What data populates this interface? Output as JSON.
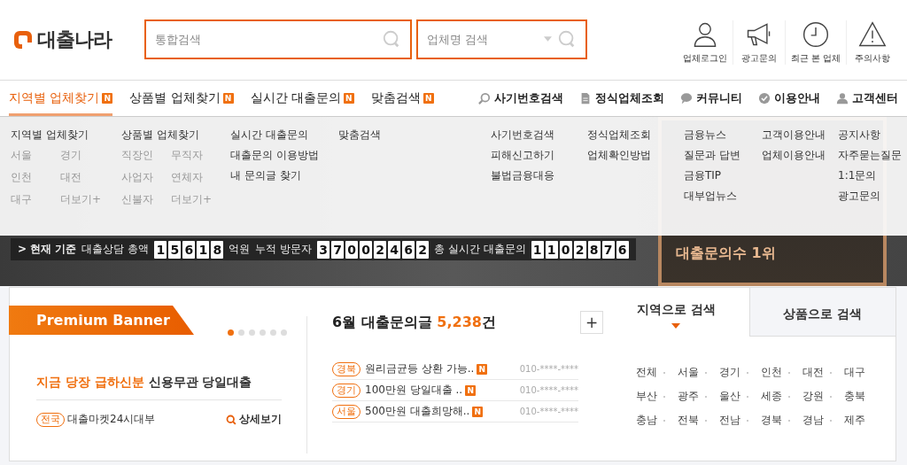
{
  "header": {
    "logo": "대출나라",
    "search": {
      "placeholder": "통합검색"
    },
    "company_search": {
      "placeholder": "업체명 검색"
    },
    "shortcuts": [
      {
        "kind": "person",
        "label": "업체로그인"
      },
      {
        "kind": "megaphone",
        "label": "광고문의"
      },
      {
        "kind": "clock",
        "label": "최근 본 업체"
      },
      {
        "kind": "warning",
        "label": "주의사항"
      }
    ]
  },
  "nav": {
    "main": [
      {
        "label": "지역별 업체찾기",
        "badge": "N",
        "selected": true
      },
      {
        "label": "상품별 업체찾기",
        "badge": "N",
        "selected": false
      },
      {
        "label": "실시간 대출문의",
        "badge": "N",
        "selected": false
      },
      {
        "label": "맞춤검색",
        "badge": "N",
        "selected": false
      }
    ],
    "utility": [
      {
        "kind": "search",
        "label": "사기번호검색"
      },
      {
        "kind": "document",
        "label": "정식업체조회"
      },
      {
        "kind": "chat",
        "label": "커뮤니티"
      },
      {
        "kind": "check",
        "label": "이용안내"
      },
      {
        "kind": "person",
        "label": "고객센터"
      }
    ]
  },
  "menu_panel": {
    "columns": [
      {
        "kind": "grid",
        "title": "지역별 업체찾기",
        "items": [
          "서울",
          "경기",
          "인천",
          "대전",
          "대구",
          "더보기+"
        ]
      },
      {
        "kind": "grid",
        "title": "상품별 업체찾기",
        "items": [
          "직장인",
          "무직자",
          "사업자",
          "연체자",
          "신불자",
          "더보기+"
        ]
      },
      {
        "kind": "list",
        "title": "실시간 대출문의",
        "items": [
          "대출문의 이용방법",
          "내 문의글 찾기"
        ]
      },
      {
        "kind": "list",
        "title": "맞춤검색"
      },
      {
        "kind": "list",
        "title": "사기번호검색",
        "items": [
          "피해신고하기",
          "불법금융대응"
        ]
      },
      {
        "kind": "list",
        "title": "정식업체조회",
        "items": [
          "업체확인방법"
        ]
      },
      {
        "kind": "list",
        "title": "금융뉴스",
        "items": [
          "질문과 답변",
          "금융TIP",
          "대부업뉴스"
        ]
      },
      {
        "kind": "list",
        "title": "고객이용안내",
        "items": [
          "업체이용안내"
        ]
      },
      {
        "kind": "list",
        "title": "공지사항",
        "items": [
          "자주묻는질문",
          "1:1문의",
          "광고문의"
        ]
      }
    ]
  },
  "stats_bar": {
    "prefix": "> 현재 기준",
    "items": [
      {
        "label": "대출상담 총액",
        "digits": [
          "1",
          "5",
          "6",
          "1",
          "8"
        ],
        "unit": "억원"
      },
      {
        "label": "누적 방문자",
        "digits": [
          "3",
          "7",
          "0",
          "0",
          "2",
          "4",
          "6",
          "2"
        ]
      },
      {
        "label": "총 실시간 대출문의",
        "digits": [
          "1",
          "1",
          "0",
          "2",
          "8",
          "7",
          "6"
        ]
      }
    ]
  },
  "hero_badge": {
    "text": "대출문의수 1위"
  },
  "premium": {
    "title": "Premium Banner",
    "dots": [
      {
        "selected": true
      },
      {
        "selected": false
      },
      {
        "selected": false
      },
      {
        "selected": false
      },
      {
        "selected": false
      },
      {
        "selected": false
      }
    ],
    "headline_highlight": "지금 당장 급하신분",
    "headline": "신용무관 당일대출",
    "region": "전국",
    "company": "대출마켓24시대부",
    "link": "상세보기"
  },
  "inquiries": {
    "title": "6월 대출문의글",
    "count": "5,238",
    "unit": "건",
    "more": "+",
    "rows": [
      {
        "region": "경북",
        "text": "원리금균등 상환 가능..",
        "badge": "N",
        "phone": "010-****-****"
      },
      {
        "region": "경기",
        "text": "100만원 당일대출 ..",
        "badge": "N",
        "phone": "010-****-****"
      },
      {
        "region": "서울",
        "text": "500만원 대출희망해..",
        "badge": "N",
        "phone": "010-****-****"
      }
    ]
  },
  "region_search": {
    "tabs": [
      {
        "label": "지역으로 검색",
        "selected": true
      },
      {
        "label": "상품으로 검색",
        "selected": false
      }
    ],
    "regions": [
      "전체",
      "서울",
      "경기",
      "인천",
      "대전",
      "대구",
      "부산",
      "광주",
      "울산",
      "세종",
      "강원",
      "충북",
      "충남",
      "전북",
      "전남",
      "경북",
      "경남",
      "제주"
    ]
  }
}
